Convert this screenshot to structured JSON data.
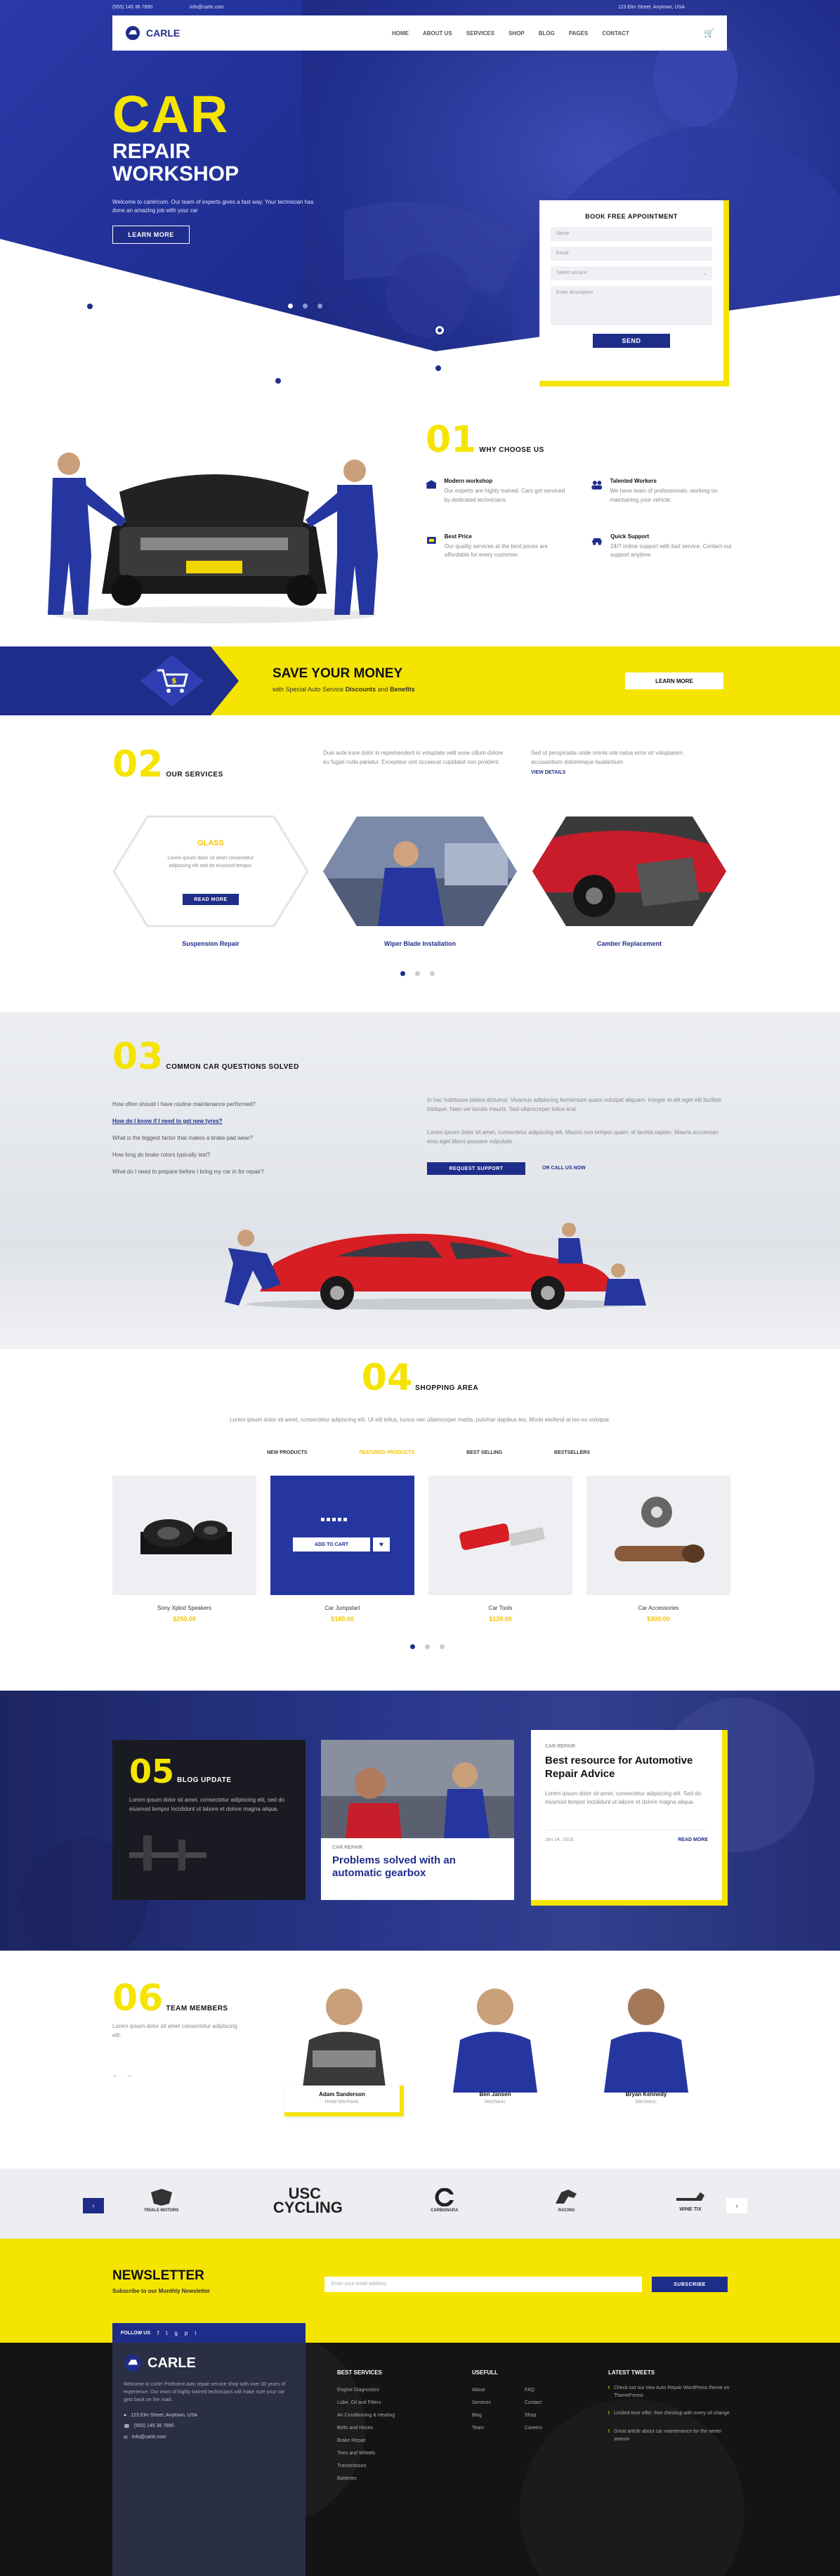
{
  "topbar": {
    "phone": "(555) 145 36 7890",
    "email": "info@carle.com",
    "address": "123 Elm Street, Anytown, USA"
  },
  "brand": {
    "name": "CARLE"
  },
  "nav": {
    "items": [
      "HOME",
      "ABOUT US",
      "SERVICES",
      "SHOP",
      "BLOG",
      "PAGES",
      "CONTACT"
    ]
  },
  "hero": {
    "title_big": "CAR",
    "title_line2": "REPAIR",
    "title_line3": "WORKSHOP",
    "paragraph": "Welcome to carle!com. Our team of experts gives a fast way. Your technician has done an amazing job with your car",
    "cta": "LEARN MORE"
  },
  "appointment": {
    "title": "BOOK FREE APPOINTMENT",
    "name_placeholder": "Name",
    "email_placeholder": "Email",
    "service_placeholder": "Select service",
    "message_placeholder": "Enter description",
    "submit": "SEND"
  },
  "why": {
    "num": "01",
    "title": "WHY CHOOSE US",
    "features": [
      {
        "title": "Modern workshop",
        "text": "Our experts are highly trained. Cars get serviced by dedicated technicians."
      },
      {
        "title": "Talented Workers",
        "text": "We have team of professionals, working on maintaining your vehicle."
      },
      {
        "title": "Best Price",
        "text": "Our quality services at the best prices are affordable for every customer."
      },
      {
        "title": "Quick Support",
        "text": "24/7 online support with fast service. Contact our support anytime."
      }
    ]
  },
  "banner": {
    "title": "SAVE YOUR MONEY",
    "subtitle_pre": "with Special Auto Service",
    "subtitle_b1": "Discounts",
    "subtitle_mid": "and",
    "subtitle_b2": "Benefits",
    "cta": "LEARN MORE"
  },
  "services": {
    "num": "02",
    "title": "OUR SERVICES",
    "col1": "Duis aute irure dolor in reprehenderit in voluptate velit esse cillum dolore eu fugiat nulla pariatur. Excepteur sint occaecat cupidatat non proident.",
    "col2": "Sed ut perspiciatis unde omnis iste natus error sit voluptatem accusantium doloremque laudantium.",
    "more": "VIEW DETAILS",
    "hex_title": "GLASS",
    "hex_text": "Lorem ipsum dolor sit amet consectetur adipiscing elit sed do eiusmod tempor.",
    "hex_button": "READ MORE",
    "items": [
      "Suspension Repair",
      "Wiper Blade Installation",
      "Camber Replacement"
    ]
  },
  "faq": {
    "num": "03",
    "title": "COMMON CAR QUESTIONS SOLVED",
    "questions": [
      "How often should I have routine maintenance performed?",
      "How do I know if I need to get new tyres?",
      "What is the biggest factor that makes a brake pad wear?",
      "How long do brake rotors typically last?",
      "What do I need to prepare before I bring my car in for repair?"
    ],
    "answer1": "In hac habitasse platea dictumst. Vivamus adipiscing fermentum quam volutpat aliquam. Integer et elit eget elit facilisis tristique. Nam vel iaculis mauris. Sed ullamcorper tellus erat.",
    "answer2": "Lorem ipsum dolor sit amet, consectetur adipiscing elit. Mauris non tempor quam, et lacinia sapien. Mauris accumsan eros eget libero posuere vulputate.",
    "btn1": "REQUEST SUPPORT",
    "btn2": "OR CALL US NOW"
  },
  "shop": {
    "num": "04",
    "title": "SHOPPING AREA",
    "intro": "Lorem ipsum dolor sit amet, consectetur adipiscing elit. Ut elit tellus, luctus nec ullamcorper mattis, pulvinar dapibus leo. Morbi eleifend at leo eu volutpat.",
    "tabs": [
      "NEW PRODUCTS",
      "FEATURED PRODUCTS",
      "BEST SELLING",
      "BESTSELLERS"
    ],
    "add_to_cart": "ADD TO CART",
    "products": [
      {
        "name": "Sony Xplod Speakers",
        "price": "$250.00"
      },
      {
        "name": "Car Jumpstart",
        "price": "$180.00"
      },
      {
        "name": "Car Tools",
        "price": "$120.00"
      },
      {
        "name": "Car Accessories",
        "price": "$300.00"
      }
    ]
  },
  "blog": {
    "num": "05",
    "title": "BLOG UPDATE",
    "text": "Lorem ipsum dolor sit amet, consectetur adipiscing elit, sed do eiusmod tempor incididunt ut labore et dolore magna aliqua.",
    "post1_cat": "CAR REPAIR",
    "post1_title": "Problems solved with an automatic gearbox",
    "post2_cat": "CAR REPAIR",
    "post2_title": "Best resource for Automotive Repair Advice",
    "post2_text": "Lorem ipsum dolor sit amet, consectetur adipiscing elit. Sed do eiusmod tempor incididunt ut labore et dolore magna aliqua.",
    "post2_date": "Jan 14, 2018",
    "post2_more": "READ MORE"
  },
  "team": {
    "num": "06",
    "title": "TEAM MEMBERS",
    "text": "Lorem ipsum dolor sit amet consectetur adipiscing elit.",
    "members": [
      {
        "name": "Adam Sanderson",
        "role": "Head Mechanic"
      },
      {
        "name": "Ben Jansen",
        "role": "Mechanic"
      },
      {
        "name": "Bryan Kennedy",
        "role": "Mechanic"
      }
    ]
  },
  "partners": [
    "TRIALS MOTORS",
    "USC CYCLING",
    "CARBONARA",
    "RACING",
    "WINE TIX"
  ],
  "newsletter": {
    "title": "NEWSLETTER",
    "subtitle": "Subscribe to our Monthly Newsletter",
    "placeholder": "Enter your email address",
    "button": "SUBSCRIBE"
  },
  "footer": {
    "follow": "FOLLOW US",
    "about": "Welcome to carle! Proficient auto repair service shop with over 30 years of experience. Our team of highly trained technicians will make sure your car gets back on the road.",
    "address": "123 Elm Street, Anytown, USA",
    "phone": "(555) 145 36 7890",
    "email": "info@carle.com",
    "col_titles": [
      "BEST SERVICES",
      "USEFULL",
      "LATEST TWEETS"
    ],
    "services_links": [
      "Engine Diagnostics",
      "Lube, Oil and Filters",
      "Air Conditioning & Heating",
      "Belts and Hoses",
      "Brake Repair",
      "Tires and Wheels",
      "Transmission",
      "Batteries"
    ],
    "useful_links": [
      "About",
      "FAQ",
      "Services",
      "Contact",
      "Blog",
      "Shop",
      "Team",
      "Careers"
    ],
    "tweets": [
      "Check out our new Auto Repair WordPress theme on ThemeForest",
      "Limited time offer: free checkup with every oil change",
      "Great article about car maintenance for the winter season"
    ]
  }
}
